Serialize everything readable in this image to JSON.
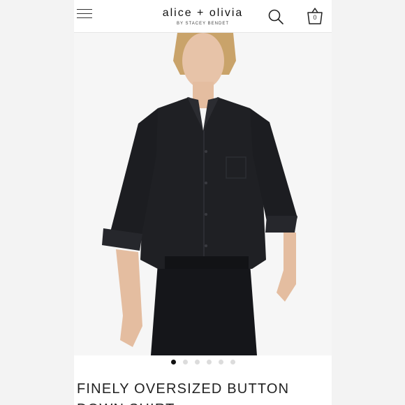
{
  "header": {
    "brand": "alice + olivia",
    "brand_sub": "BY STACEY BENDET",
    "bag_count": "0"
  },
  "carousel": {
    "slide_count": 6,
    "active_index": 0
  },
  "product": {
    "title": "FINELY OVERSIZED BUTTON DOWN SHIRT"
  },
  "colors": {
    "shirt": "#1f2024",
    "background": "#f3f3f3",
    "text": "#222222"
  },
  "icons": [
    "menu-icon",
    "search-icon",
    "shopping-bag-icon"
  ]
}
